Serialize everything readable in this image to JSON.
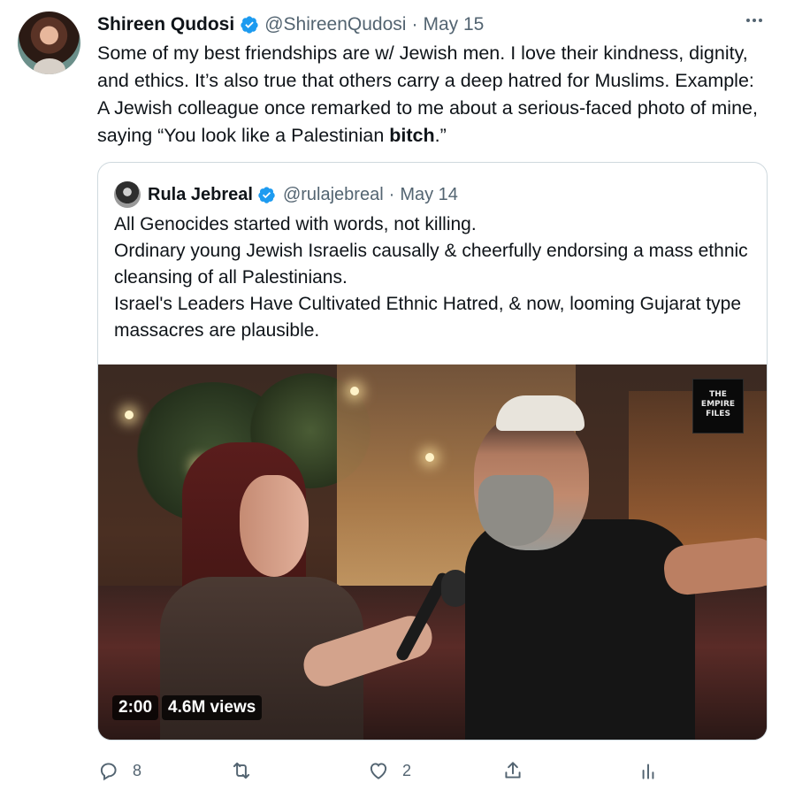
{
  "author": {
    "name": "Shireen Qudosi",
    "handle": "@ShireenQudosi",
    "date": "May 15"
  },
  "tweet": {
    "text_before": "Some of my best friendships are w/ Jewish men. I love their kindness, dignity, and ethics. It’s also true that others carry a deep hatred for Muslims. Example: A Jewish colleague once remarked to me about a serious-faced photo of mine, saying “You look like a Palestinian ",
    "text_bold": "bitch",
    "text_after": ".”"
  },
  "quote": {
    "name": "Rula Jebreal",
    "handle": "@rulajebreal",
    "date": "May 14",
    "lines": [
      "All Genocides started with words, not killing.",
      "Ordinary young Jewish Israelis causally & cheerfully endorsing a mass ethnic cleansing of all Palestinians.",
      "Israel's Leaders Have Cultivated Ethnic Hatred, & now, looming Gujarat type massacres are plausible."
    ],
    "video": {
      "duration": "2:00",
      "views": "4.6M views",
      "logo_line1": "THE",
      "logo_line2": "EMPIRE",
      "logo_line3": "FILES"
    }
  },
  "actions": {
    "reply_count": "8",
    "retweet_count": "",
    "like_count": "2"
  },
  "colors": {
    "verified": "#1d9bf0",
    "muted": "#536471",
    "border": "#cfd9de"
  }
}
